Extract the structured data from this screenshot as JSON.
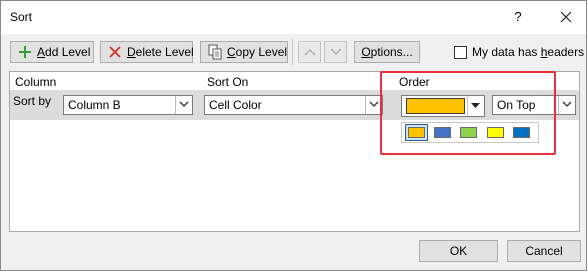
{
  "window": {
    "title": "Sort",
    "help_label": "?"
  },
  "toolbar": {
    "add_level": {
      "underline": "A",
      "rest": "dd Level"
    },
    "delete_level": {
      "underline": "D",
      "rest": "elete Level"
    },
    "copy_level": {
      "underline": "C",
      "rest": "opy Level"
    },
    "options": {
      "underline": "O",
      "rest": "ptions..."
    },
    "headers_checkbox": {
      "label_pre": "My data has ",
      "underline": "h",
      "label_post": "eaders",
      "checked": false
    }
  },
  "grid": {
    "columns": [
      "Column",
      "Sort On",
      "Order"
    ],
    "row": {
      "label": "Sort by",
      "column_value": "Column B",
      "sort_on_value": "Cell Color",
      "order_color": "#ffc000",
      "position_value": "On Top"
    },
    "palette": [
      {
        "name": "gold",
        "color": "#ffc000",
        "selected": true
      },
      {
        "name": "blue",
        "color": "#4472c4",
        "selected": false
      },
      {
        "name": "green",
        "color": "#92d050",
        "selected": false
      },
      {
        "name": "yellow",
        "color": "#ffff00",
        "selected": false
      },
      {
        "name": "dark-blue",
        "color": "#0070c0",
        "selected": false
      }
    ]
  },
  "footer": {
    "ok": "OK",
    "cancel": "Cancel"
  },
  "colors": {
    "highlight": "#e8313b",
    "dialog_bg": "#f0f0f0",
    "row_band": "#dcdcdc"
  }
}
